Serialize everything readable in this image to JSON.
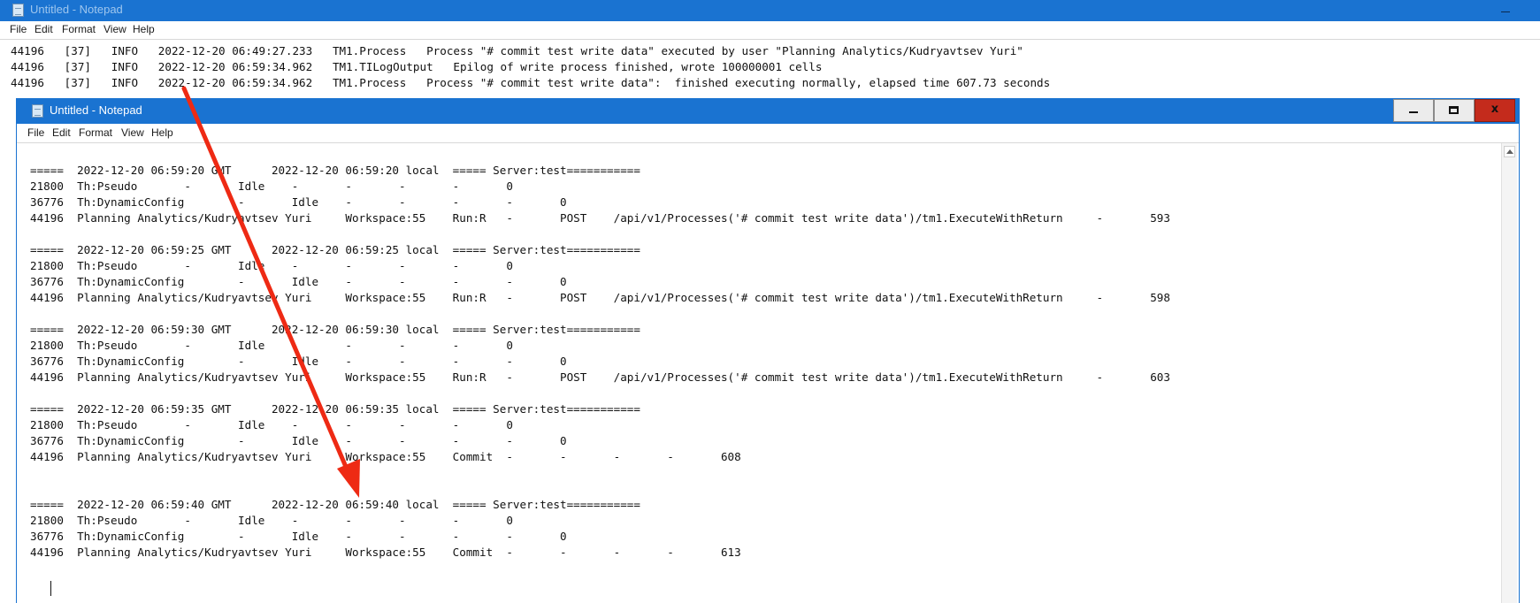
{
  "window_back": {
    "title": "Untitled - Notepad",
    "menu": [
      "File",
      "Edit",
      "Format",
      "View",
      "Help"
    ],
    "lines": [
      "44196   [37]   INFO   2022-12-20 06:49:27.233   TM1.Process   Process \"# commit test write data\" executed by user \"Planning Analytics/Kudryavtsev Yuri\"",
      "44196   [37]   INFO   2022-12-20 06:59:34.962   TM1.TILogOutput   Epilog of write process finished, wrote 100000001 cells",
      "44196   [37]   INFO   2022-12-20 06:59:34.962   TM1.Process   Process \"# commit test write data\":  finished executing normally, elapsed time 607.73 seconds"
    ]
  },
  "window_front": {
    "title": "Untitled - Notepad",
    "menu": [
      "File",
      "Edit",
      "Format",
      "View",
      "Help"
    ],
    "buttons": {
      "minimize": "minimize",
      "maximize": "maximize",
      "close": "x"
    },
    "lines": [
      "",
      "=====  2022-12-20 06:59:20 GMT      2022-12-20 06:59:20 local  ===== Server:test===========",
      "21800  Th:Pseudo       -       Idle    -       -       -       -       0",
      "36776  Th:DynamicConfig        -       Idle    -       -       -       -       0",
      "44196  Planning Analytics/Kudryavtsev Yuri     Workspace:55    Run:R   -       POST    /api/v1/Processes('# commit test write data')/tm1.ExecuteWithReturn     -       593",
      "",
      "=====  2022-12-20 06:59:25 GMT      2022-12-20 06:59:25 local  ===== Server:test===========",
      "21800  Th:Pseudo       -       Idle    -       -       -       -       0",
      "36776  Th:DynamicConfig        -       Idle    -       -       -       -       0",
      "44196  Planning Analytics/Kudryavtsev Yuri     Workspace:55    Run:R   -       POST    /api/v1/Processes('# commit test write data')/tm1.ExecuteWithReturn     -       598",
      "",
      "=====  2022-12-20 06:59:30 GMT      2022-12-20 06:59:30 local  ===== Server:test===========",
      "21800  Th:Pseudo       -       Idle    -       -       -       -       0",
      "36776  Th:DynamicConfig        -       Idle    -       -       -       -       0",
      "44196  Planning Analytics/Kudryavtsev Yuri     Workspace:55    Run:R   -       POST    /api/v1/Processes('# commit test write data')/tm1.ExecuteWithReturn     -       603",
      "",
      "=====  2022-12-20 06:59:35 GMT      2022-12-20 06:59:35 local  ===== Server:test===========",
      "21800  Th:Pseudo       -       Idle    -       -       -       -       0",
      "36776  Th:DynamicConfig        -       Idle    -       -       -       -       0",
      "44196  Planning Analytics/Kudryavtsev Yuri     Workspace:55    Commit  -       -       -       -       608",
      "",
      "",
      "=====  2022-12-20 06:59:40 GMT      2022-12-20 06:59:40 local  ===== Server:test===========",
      "21800  Th:Pseudo       -       Idle    -       -       -       -       0",
      "36776  Th:DynamicConfig        -       Idle    -       -       -       -       0",
      "44196  Planning Analytics/Kudryavtsev Yuri     Workspace:55    Commit  -       -       -       -       613"
    ]
  },
  "annotation": {
    "arrow_color": "#ee2a14"
  },
  "colors": {
    "titlebar": "#1a73d1",
    "close_button": "#c42b1c"
  },
  "icons": {
    "app": "notepad-icon"
  }
}
